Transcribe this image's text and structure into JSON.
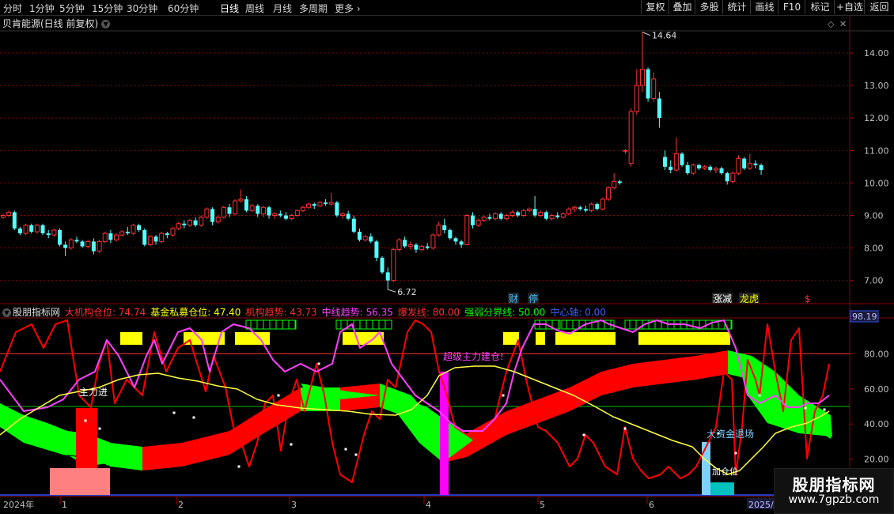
{
  "toolbar": {
    "timeframes": [
      "分时",
      "1分钟",
      "5分钟",
      "15分钟",
      "30分钟",
      "60分钟",
      "日线",
      "周线",
      "月线",
      "多周期",
      "更多"
    ],
    "active_timeframe": "日线",
    "right_buttons": [
      "复权",
      "叠加",
      "多股",
      "统计",
      "画线",
      "F10",
      "标记",
      "+自选",
      "返回"
    ]
  },
  "main_panel": {
    "title": "贝肯能源(日线 前复权)",
    "price_axis": [
      "14.00",
      "13.00",
      "12.00",
      "11.00",
      "10.00",
      "9.00",
      "8.00",
      "7.00"
    ],
    "high_label": "14.64",
    "low_label": "6.72",
    "event_labels": [
      {
        "text": "财",
        "color": "#40c0ff"
      },
      {
        "text": "停",
        "color": "#40c0ff"
      },
      {
        "text": "涨减",
        "color": "#ffffff"
      },
      {
        "text": "龙虎",
        "color": "#ffff00"
      },
      {
        "text": "$",
        "color": "#ff3030"
      }
    ]
  },
  "indicator_panel": {
    "name": "股朋指标网",
    "items": [
      {
        "label": "大机构仓位:",
        "value": "74.74",
        "color": "#ff3030"
      },
      {
        "label": "基金私募仓位:",
        "value": "47.40",
        "color": "#ffff00"
      },
      {
        "label": "机构趋势:",
        "value": "43.73",
        "color": "#ff3030"
      },
      {
        "label": "中线趋势:",
        "value": "56.35",
        "color": "#ff40ff"
      },
      {
        "label": "爆发线:",
        "value": "80.00",
        "color": "#ff3030"
      },
      {
        "label": "强弱分界线:",
        "value": "50.00",
        "color": "#00ff00"
      },
      {
        "label": "中心轴:",
        "value": "0.00",
        "color": "#4060ff"
      }
    ],
    "axis_top_value": "98.19",
    "axis": [
      "80.00",
      "60.00",
      "40.00",
      "20.00"
    ],
    "annotations": {
      "main_force_in": "主力进",
      "super_main_force": "超级主力建仓!",
      "big_money_exit": "大资金退场",
      "fill_position": "加仓位"
    }
  },
  "date_axis": {
    "year_start": "2024年",
    "months": [
      "1",
      "2",
      "3",
      "4",
      "5",
      "6"
    ],
    "year_end": "2025/0"
  },
  "watermark": {
    "title": "股朋指标网",
    "url": "www.7gpzb.com"
  },
  "colors": {
    "up": "#ff3232",
    "down": "#54ffff",
    "background": "#000000",
    "grid": "#8b0000"
  },
  "chart_data": {
    "type": "candlestick",
    "ylim": [
      6.5,
      15.0
    ],
    "candles": [
      [
        8.95,
        9.05,
        8.9,
        9.0
      ],
      [
        9.0,
        9.15,
        8.95,
        9.1
      ],
      [
        9.1,
        9.15,
        8.55,
        8.6
      ],
      [
        8.6,
        8.65,
        8.4,
        8.45
      ],
      [
        8.45,
        8.75,
        8.4,
        8.7
      ],
      [
        8.7,
        8.75,
        8.45,
        8.5
      ],
      [
        8.5,
        8.75,
        8.45,
        8.7
      ],
      [
        8.7,
        8.75,
        8.4,
        8.45
      ],
      [
        8.45,
        8.55,
        8.3,
        8.4
      ],
      [
        8.4,
        8.6,
        8.35,
        8.55
      ],
      [
        8.55,
        8.6,
        8.05,
        8.1
      ],
      [
        8.1,
        8.2,
        7.75,
        8.0
      ],
      [
        8.0,
        8.3,
        7.95,
        8.25
      ],
      [
        8.25,
        8.35,
        8.15,
        8.2
      ],
      [
        8.2,
        8.25,
        8.0,
        8.05
      ],
      [
        8.05,
        8.25,
        8.0,
        8.2
      ],
      [
        8.2,
        8.3,
        7.8,
        7.9
      ],
      [
        7.9,
        8.25,
        7.85,
        8.2
      ],
      [
        8.2,
        8.5,
        8.15,
        8.45
      ],
      [
        8.45,
        8.55,
        8.15,
        8.25
      ],
      [
        8.25,
        8.45,
        8.2,
        8.4
      ],
      [
        8.4,
        8.55,
        8.35,
        8.5
      ],
      [
        8.5,
        8.65,
        8.4,
        8.45
      ],
      [
        8.45,
        8.75,
        8.4,
        8.7
      ],
      [
        8.7,
        8.75,
        8.5,
        8.55
      ],
      [
        8.55,
        8.6,
        8.05,
        8.1
      ],
      [
        8.1,
        8.4,
        8.05,
        8.35
      ],
      [
        8.35,
        8.4,
        8.1,
        8.2
      ],
      [
        8.2,
        8.5,
        8.15,
        8.45
      ],
      [
        8.45,
        8.5,
        8.3,
        8.4
      ],
      [
        8.4,
        8.65,
        8.35,
        8.6
      ],
      [
        8.6,
        8.8,
        8.55,
        8.75
      ],
      [
        8.75,
        8.85,
        8.6,
        8.7
      ],
      [
        8.7,
        8.9,
        8.65,
        8.85
      ],
      [
        8.85,
        8.95,
        8.65,
        8.7
      ],
      [
        8.7,
        9.0,
        8.65,
        8.95
      ],
      [
        8.95,
        9.25,
        8.9,
        9.2
      ],
      [
        9.2,
        9.25,
        8.7,
        8.8
      ],
      [
        8.8,
        9.0,
        8.75,
        8.95
      ],
      [
        8.95,
        9.3,
        8.9,
        9.25
      ],
      [
        9.25,
        9.35,
        8.95,
        9.05
      ],
      [
        9.05,
        9.5,
        9.0,
        9.45
      ],
      [
        9.45,
        9.8,
        9.4,
        9.5
      ],
      [
        9.5,
        9.6,
        9.1,
        9.15
      ],
      [
        9.15,
        9.35,
        9.1,
        9.3
      ],
      [
        9.3,
        9.35,
        8.95,
        9.05
      ],
      [
        9.05,
        9.3,
        8.95,
        9.25
      ],
      [
        9.25,
        9.3,
        8.9,
        9.0
      ],
      [
        9.0,
        9.1,
        8.9,
        9.05
      ],
      [
        9.05,
        9.15,
        8.95,
        9.0
      ],
      [
        9.0,
        9.1,
        8.85,
        8.9
      ],
      [
        8.9,
        9.05,
        8.85,
        9.0
      ],
      [
        9.0,
        9.2,
        8.95,
        9.15
      ],
      [
        9.15,
        9.3,
        9.1,
        9.25
      ],
      [
        9.25,
        9.4,
        9.2,
        9.35
      ],
      [
        9.35,
        9.4,
        9.2,
        9.3
      ],
      [
        9.3,
        9.45,
        9.25,
        9.4
      ],
      [
        9.4,
        9.5,
        9.3,
        9.35
      ],
      [
        9.35,
        9.7,
        9.3,
        9.4
      ],
      [
        9.4,
        9.45,
        8.95,
        9.0
      ],
      [
        9.0,
        9.1,
        8.9,
        9.05
      ],
      [
        9.05,
        9.15,
        8.85,
        8.9
      ],
      [
        8.9,
        9.0,
        8.45,
        8.5
      ],
      [
        8.5,
        8.6,
        8.2,
        8.25
      ],
      [
        8.25,
        8.4,
        8.2,
        8.35
      ],
      [
        8.35,
        8.45,
        8.15,
        8.2
      ],
      [
        8.2,
        8.25,
        7.6,
        7.7
      ],
      [
        7.7,
        7.75,
        7.2,
        7.25
      ],
      [
        7.25,
        7.4,
        6.72,
        7.0
      ],
      [
        7.0,
        8.0,
        6.95,
        7.95
      ],
      [
        7.95,
        8.3,
        7.9,
        8.25
      ],
      [
        8.25,
        8.35,
        8.0,
        8.05
      ],
      [
        8.05,
        8.2,
        7.95,
        8.1
      ],
      [
        8.1,
        8.15,
        7.85,
        7.95
      ],
      [
        7.95,
        8.1,
        7.9,
        8.05
      ],
      [
        8.05,
        8.15,
        7.95,
        8.0
      ],
      [
        8.0,
        8.45,
        7.95,
        8.4
      ],
      [
        8.4,
        8.8,
        8.35,
        8.7
      ],
      [
        8.7,
        8.9,
        8.45,
        8.55
      ],
      [
        8.55,
        8.6,
        8.25,
        8.3
      ],
      [
        8.3,
        8.35,
        8.1,
        8.2
      ],
      [
        8.2,
        8.25,
        8.0,
        8.1
      ],
      [
        8.1,
        9.05,
        8.1,
        9.0
      ],
      [
        9.0,
        9.1,
        8.6,
        8.7
      ],
      [
        8.7,
        8.9,
        8.65,
        8.85
      ],
      [
        8.85,
        9.0,
        8.8,
        8.95
      ],
      [
        8.95,
        9.05,
        8.85,
        8.9
      ],
      [
        8.9,
        9.1,
        8.85,
        9.05
      ],
      [
        9.05,
        9.1,
        8.85,
        8.9
      ],
      [
        8.9,
        9.05,
        8.85,
        9.0
      ],
      [
        9.0,
        9.15,
        8.95,
        9.1
      ],
      [
        9.1,
        9.15,
        8.95,
        9.0
      ],
      [
        9.0,
        9.2,
        8.95,
        9.15
      ],
      [
        9.15,
        9.25,
        9.1,
        9.2
      ],
      [
        9.2,
        9.6,
        8.95,
        9.0
      ],
      [
        9.0,
        9.15,
        8.95,
        9.1
      ],
      [
        9.1,
        9.15,
        8.85,
        8.9
      ],
      [
        8.9,
        9.05,
        8.85,
        9.0
      ],
      [
        9.0,
        9.1,
        8.9,
        8.95
      ],
      [
        8.95,
        9.1,
        8.9,
        9.05
      ],
      [
        9.05,
        9.25,
        9.0,
        9.2
      ],
      [
        9.2,
        9.3,
        9.1,
        9.25
      ],
      [
        9.25,
        9.3,
        9.15,
        9.2
      ],
      [
        9.2,
        9.3,
        9.1,
        9.15
      ],
      [
        9.15,
        9.4,
        9.1,
        9.35
      ],
      [
        9.35,
        9.4,
        9.15,
        9.2
      ],
      [
        9.2,
        9.55,
        9.15,
        9.5
      ],
      [
        9.5,
        9.9,
        9.45,
        9.85
      ],
      [
        9.85,
        10.3,
        9.8,
        10.05
      ],
      [
        10.05,
        10.1,
        9.95,
        10.0
      ],
      [
        11.0,
        11.05,
        10.9,
        11.0
      ],
      [
        10.6,
        12.3,
        10.5,
        12.2
      ],
      [
        12.2,
        13.5,
        12.1,
        13.0
      ],
      [
        13.0,
        14.64,
        12.8,
        13.5
      ],
      [
        13.5,
        13.55,
        12.5,
        12.6
      ],
      [
        12.6,
        13.4,
        12.5,
        13.2
      ],
      [
        12.6,
        12.8,
        11.7,
        12.0
      ],
      [
        10.8,
        11.0,
        10.4,
        10.5
      ],
      [
        10.5,
        10.7,
        10.3,
        10.4
      ],
      [
        10.4,
        11.4,
        10.35,
        10.9
      ],
      [
        10.9,
        10.95,
        10.5,
        10.55
      ],
      [
        10.55,
        10.65,
        10.25,
        10.3
      ],
      [
        10.3,
        10.6,
        10.25,
        10.55
      ],
      [
        10.55,
        10.6,
        10.4,
        10.45
      ],
      [
        10.45,
        10.55,
        10.4,
        10.5
      ],
      [
        10.5,
        10.55,
        10.35,
        10.4
      ],
      [
        10.4,
        10.5,
        10.3,
        10.45
      ],
      [
        10.45,
        10.5,
        10.25,
        10.3
      ],
      [
        10.3,
        10.35,
        9.95,
        10.05
      ],
      [
        10.05,
        10.35,
        10.0,
        10.3
      ],
      [
        10.3,
        10.85,
        10.25,
        10.75
      ],
      [
        10.75,
        10.8,
        10.4,
        10.45
      ],
      [
        10.45,
        10.9,
        10.4,
        10.6
      ],
      [
        10.6,
        10.7,
        10.45,
        10.55
      ],
      [
        10.55,
        10.6,
        10.25,
        10.4
      ]
    ]
  }
}
